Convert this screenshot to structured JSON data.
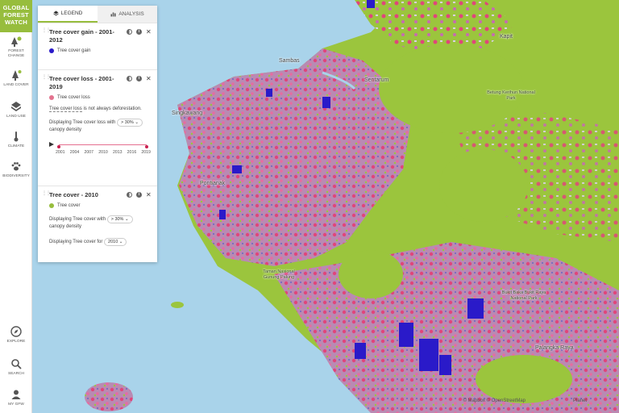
{
  "sidebar": {
    "logo_lines": [
      "GLOBAL",
      "FOREST",
      "WATCH"
    ],
    "items": [
      {
        "label": "FOREST CHANGE",
        "icon": "tree-change-icon"
      },
      {
        "label": "LAND COVER",
        "icon": "tree-icon"
      },
      {
        "label": "LAND USE",
        "icon": "land-use-icon"
      },
      {
        "label": "CLIMATE",
        "icon": "thermometer-icon"
      },
      {
        "label": "BIODIVERSITY",
        "icon": "paw-icon"
      }
    ],
    "bottom_items": [
      {
        "label": "EXPLORE",
        "icon": "compass-icon"
      },
      {
        "label": "SEARCH",
        "icon": "search-icon"
      },
      {
        "label": "MY GFW",
        "icon": "user-icon"
      }
    ]
  },
  "legend": {
    "tabs": [
      {
        "label": "LEGEND",
        "icon": "layers-icon",
        "active": true
      },
      {
        "label": "ANALYSIS",
        "icon": "bar-chart-icon",
        "active": false
      }
    ],
    "layers": [
      {
        "title": "Tree cover gain - 2001-2012",
        "swatch_color": "#2a1ac9",
        "swatch_label": "Tree cover gain"
      },
      {
        "title": "Tree cover loss - 2001-2019",
        "swatch_color": "#e3738f",
        "swatch_label": "Tree cover loss",
        "note_underlined": "Tree cover loss",
        "note_rest": " is not always deforestation.",
        "setting_prefix": "Displaying Tree cover loss with",
        "setting_value": "> 30% ⌄",
        "setting_suffix": "canopy density",
        "timeline_start": "2001",
        "timeline_end": "2019",
        "timeline_ticks": [
          "2001",
          "2004",
          "2007",
          "2010",
          "2013",
          "2016",
          "2019"
        ]
      },
      {
        "title": "Tree cover - 2010",
        "swatch_color": "#97bd3d",
        "swatch_label": "Tree cover",
        "setting_prefix": "Displaying Tree cover with",
        "setting_value": "> 30% ⌄",
        "setting_suffix": "canopy density",
        "setting2_prefix": "Displaying Tree cover for",
        "setting2_value": "2010 ⌄"
      }
    ]
  },
  "map": {
    "labels": {
      "singkawang": "Singkawang",
      "pontianak": "Pontianak",
      "palangka_raya": "Palangka Raya",
      "kapit": "Kapit",
      "betung_kerihun": "Betung Kerihun National Park",
      "sentarum": "Sentarum",
      "gunung_palung": "Taman Nasional Gunung Palung",
      "bukit_baka": "Bukit Baka Bukit Raya National Park",
      "sambas": "Sambas"
    },
    "attribution": "© Mapbox © OpenStreetMap",
    "attribution_right": "Planet"
  },
  "colors": {
    "forest": "#9bc53d",
    "loss": "#e0457b",
    "gain": "#2a1ac9",
    "water": "#a9d3ea",
    "brand": "#97bd3d"
  }
}
